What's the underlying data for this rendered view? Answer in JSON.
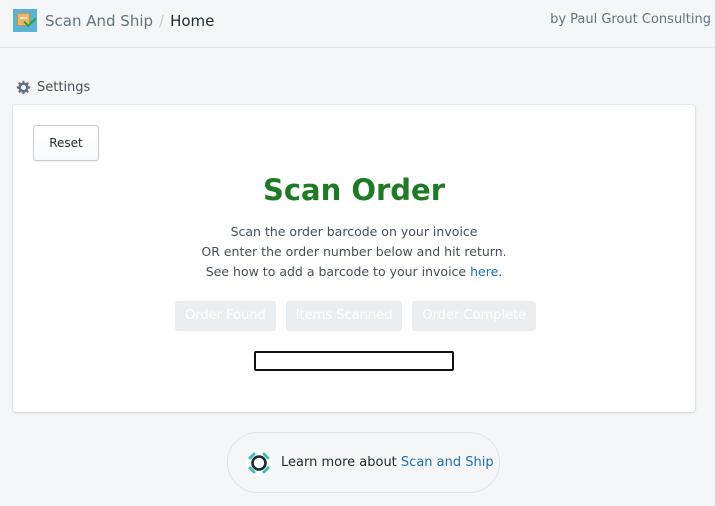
{
  "header": {
    "app_name": "Scan And Ship",
    "separator": "/",
    "page": "Home",
    "byline": "by Paul Grout Consulting"
  },
  "settings": {
    "label": "Settings"
  },
  "card": {
    "reset_label": "Reset",
    "title": "Scan Order",
    "lines": [
      "Scan the order barcode on your invoice",
      "OR enter the order number below and hit return.",
      "See how to add a barcode to your invoice "
    ],
    "link_text": "here",
    "link_suffix": ".",
    "steps": [
      "Order Found",
      "Items Scanned",
      "Order Complete"
    ],
    "input_value": ""
  },
  "footer": {
    "text": "Learn more about ",
    "link_text": "Scan and Ship"
  },
  "colors": {
    "title_green": "#1e7a24",
    "link_blue": "#1a6fb8",
    "step_disabled_bg": "#ebeef0"
  }
}
